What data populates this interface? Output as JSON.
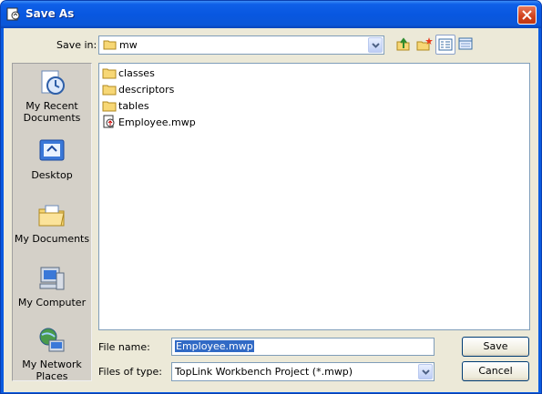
{
  "dialog": {
    "title": "Save As"
  },
  "save_in": {
    "label": "Save in:",
    "value": "mw"
  },
  "places": [
    {
      "label_line1": "My Recent",
      "label_line2": "Documents"
    },
    {
      "label_line1": "Desktop",
      "label_line2": ""
    },
    {
      "label_line1": "My Documents",
      "label_line2": ""
    },
    {
      "label_line1": "My Computer",
      "label_line2": ""
    },
    {
      "label_line1": "My Network",
      "label_line2": "Places"
    }
  ],
  "files": [
    {
      "name": "classes",
      "type": "folder"
    },
    {
      "name": "descriptors",
      "type": "folder"
    },
    {
      "name": "tables",
      "type": "folder"
    },
    {
      "name": "Employee.mwp",
      "type": "project-file"
    }
  ],
  "file_name": {
    "label": "File name:",
    "value": "Employee.mwp"
  },
  "file_type": {
    "label": "Files of type:",
    "value": "TopLink Workbench Project (*.mwp)"
  },
  "buttons": {
    "save": "Save",
    "cancel": "Cancel"
  },
  "icons": {
    "title": "save-as-dialog-icon",
    "folder": "folder-icon",
    "project_file": "toplink-project-file-icon"
  },
  "colors": {
    "titlebar": "#0b57d8",
    "client": "#ece9d8",
    "selection": "#316ac5"
  }
}
